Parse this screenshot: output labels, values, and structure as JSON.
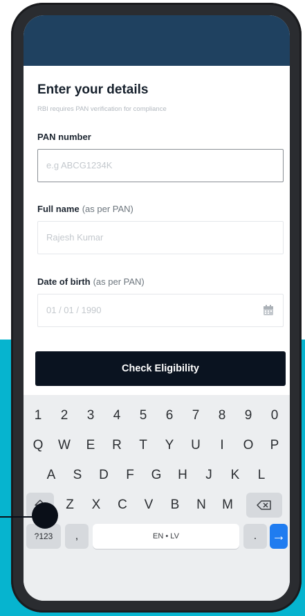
{
  "form": {
    "title": "Enter your details",
    "subtitle": "RBI requires PAN verification for compliance",
    "pan_label": "PAN number",
    "pan_placeholder": "e.g ABCG1234K",
    "name_label": "Full name",
    "name_hint": "(as per PAN)",
    "name_placeholder": "Rajesh Kumar",
    "dob_label": "Date of birth",
    "dob_hint": "(as per PAN)",
    "dob_placeholder": "01 / 01 / 1990",
    "cta_label": "Check Eligibility"
  },
  "keyboard": {
    "row1": [
      "1",
      "2",
      "3",
      "4",
      "5",
      "6",
      "7",
      "8",
      "9",
      "0"
    ],
    "row2": [
      "Q",
      "W",
      "E",
      "R",
      "T",
      "Y",
      "U",
      "I",
      "O",
      "P"
    ],
    "row3": [
      "A",
      "S",
      "D",
      "F",
      "G",
      "H",
      "J",
      "K",
      "L"
    ],
    "row4": [
      "Z",
      "X",
      "C",
      "V",
      "B",
      "N",
      "M"
    ],
    "symbols_label": "?123",
    "comma_label": ",",
    "space_label": "EN • LV",
    "period_label": ".",
    "enter_label": "→",
    "icons": {
      "shift": "shift-icon",
      "backspace": "backspace-icon",
      "calendar": "calendar-icon"
    }
  },
  "colors": {
    "appbar": "#1f4160",
    "cta": "#0a1320",
    "accent_bg": "#06b4cf",
    "enter_key": "#1f7cf0"
  }
}
